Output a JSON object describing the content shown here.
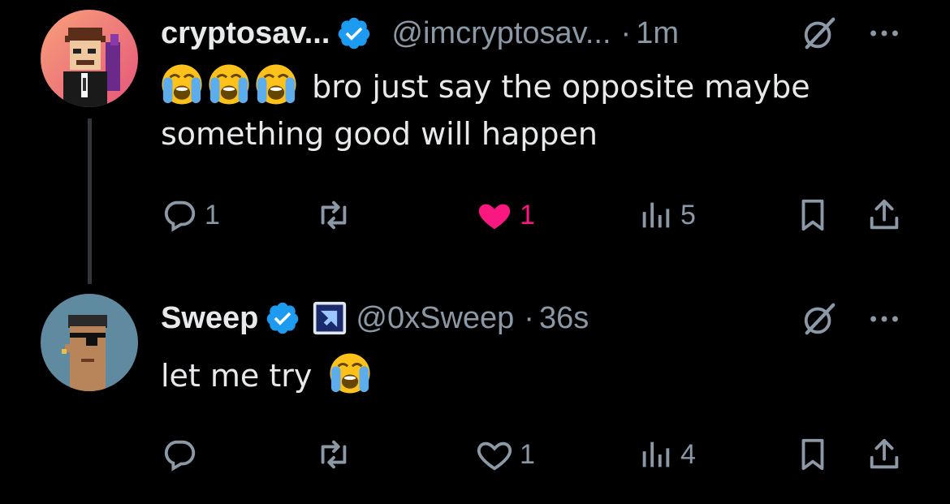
{
  "tweets": [
    {
      "name": "cryptosav...",
      "handle": "@imcryptosav...",
      "separator": "·",
      "time": "1m",
      "text": "bro just say the opposite maybe something good will happen",
      "emoji_prefix": [
        "loudly-crying-face",
        "loudly-crying-face",
        "loudly-crying-face"
      ],
      "actions": {
        "replies": "1",
        "reposts": "",
        "likes": "1",
        "views": "5",
        "liked": true
      }
    },
    {
      "name": "Sweep",
      "handle": "@0xSweep",
      "separator": "·",
      "time": "36s",
      "text": "let me try",
      "emoji_suffix": [
        "loudly-crying-face"
      ],
      "actions": {
        "replies": "",
        "reposts": "",
        "likes": "1",
        "views": "4",
        "liked": false
      }
    }
  ],
  "colors": {
    "background": "#000000",
    "text": "#e7e9ea",
    "muted": "#8b98a5",
    "verified": "#1d9bf0",
    "like": "#f91880",
    "thread_line": "#333639"
  },
  "icons": [
    "verified-badge-icon",
    "grok-icon",
    "more-icon",
    "reply-icon",
    "repost-icon",
    "like-icon",
    "views-icon",
    "bookmark-icon",
    "share-icon",
    "affiliate-badge-icon"
  ]
}
